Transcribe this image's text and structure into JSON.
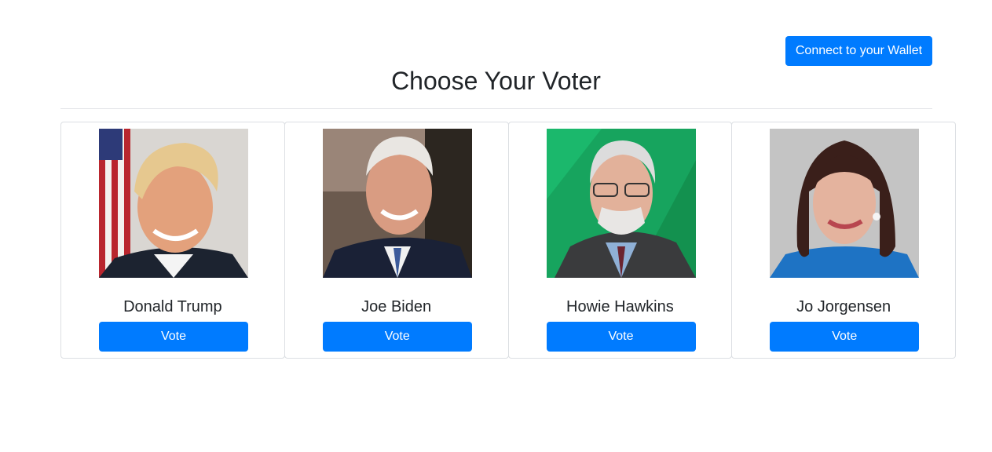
{
  "header": {
    "wallet_button_label": "Connect to your Wallet",
    "title": "Choose Your Voter"
  },
  "colors": {
    "primary": "#007bff",
    "text": "#212529",
    "border": "#dcdfe3"
  },
  "candidates": [
    {
      "name": "Donald Trump",
      "vote_label": "Vote",
      "photo": "portrait-photo"
    },
    {
      "name": "Joe Biden",
      "vote_label": "Vote",
      "photo": "portrait-photo"
    },
    {
      "name": "Howie Hawkins",
      "vote_label": "Vote",
      "photo": "portrait-photo"
    },
    {
      "name": "Jo Jorgensen",
      "vote_label": "Vote",
      "photo": "portrait-photo"
    }
  ]
}
